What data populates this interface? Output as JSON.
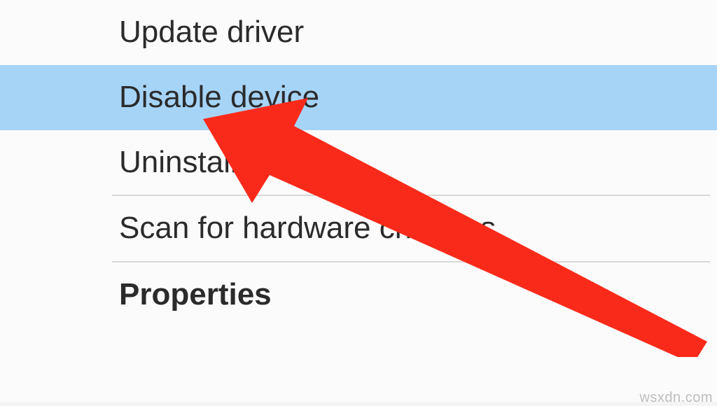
{
  "menu": {
    "items": [
      {
        "label": "Update driver",
        "bold": false,
        "selected": false
      },
      {
        "label": "Disable device",
        "bold": false,
        "selected": true
      },
      {
        "label": "Uninstall device",
        "bold": false,
        "selected": false
      },
      {
        "label": "Scan for hardware changes",
        "bold": false,
        "selected": false
      },
      {
        "label": "Properties",
        "bold": true,
        "selected": false
      }
    ]
  },
  "watermark": "wsxdn.com",
  "annotation": {
    "type": "arrow",
    "color": "#fa2a1a",
    "points_to": "Disable device"
  }
}
